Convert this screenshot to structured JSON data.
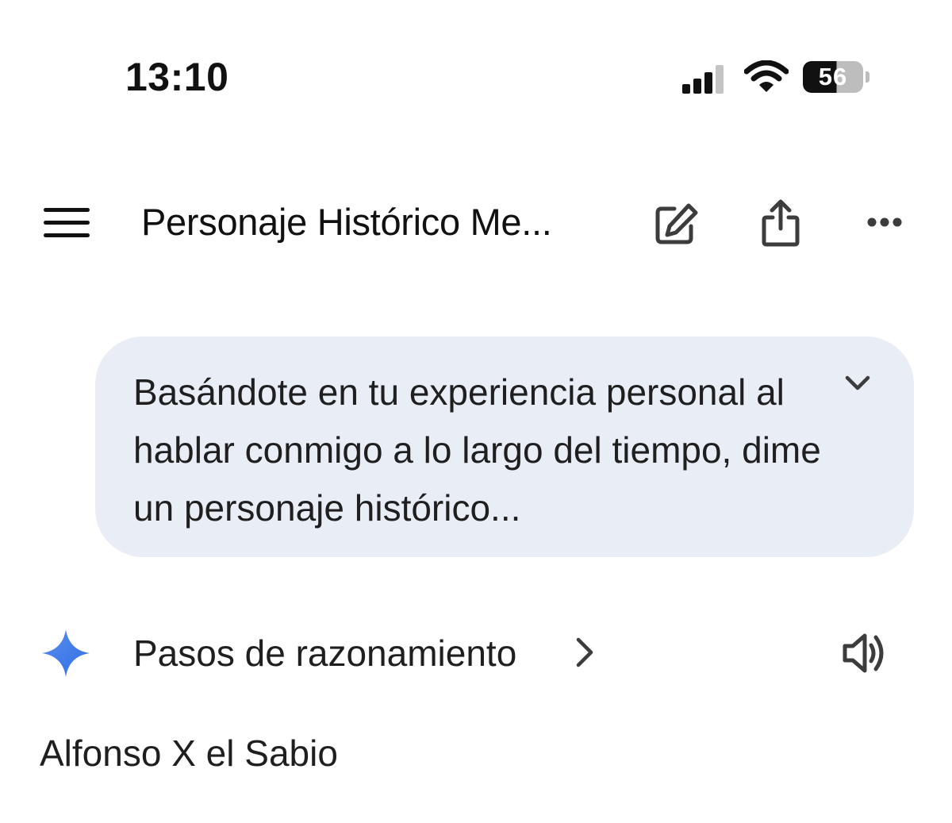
{
  "status_bar": {
    "time": "13:10",
    "battery_level": "56",
    "icons": [
      "cellular-signal-icon",
      "wifi-icon",
      "battery-icon"
    ]
  },
  "header": {
    "title": "Personaje Histórico Me...",
    "icons": [
      "menu-icon",
      "new-chat-edit-icon",
      "share-icon",
      "more-options-icon"
    ]
  },
  "user_message": {
    "text": "Basándote en tu experiencia personal al hablar conmigo a lo largo del tiempo, dime un personaje histórico...",
    "icon": "chevron-down-icon"
  },
  "response": {
    "reasoning_label": "Pasos de razonamiento",
    "answer": "Alfonso X el Sabio",
    "icons": [
      "gemini-sparkle-icon",
      "chevron-right-icon",
      "speaker-icon"
    ]
  },
  "colors": {
    "bubble_background": "#e9eef6",
    "sparkle_blue": "#4285f4",
    "text": "#1f1f1f"
  }
}
